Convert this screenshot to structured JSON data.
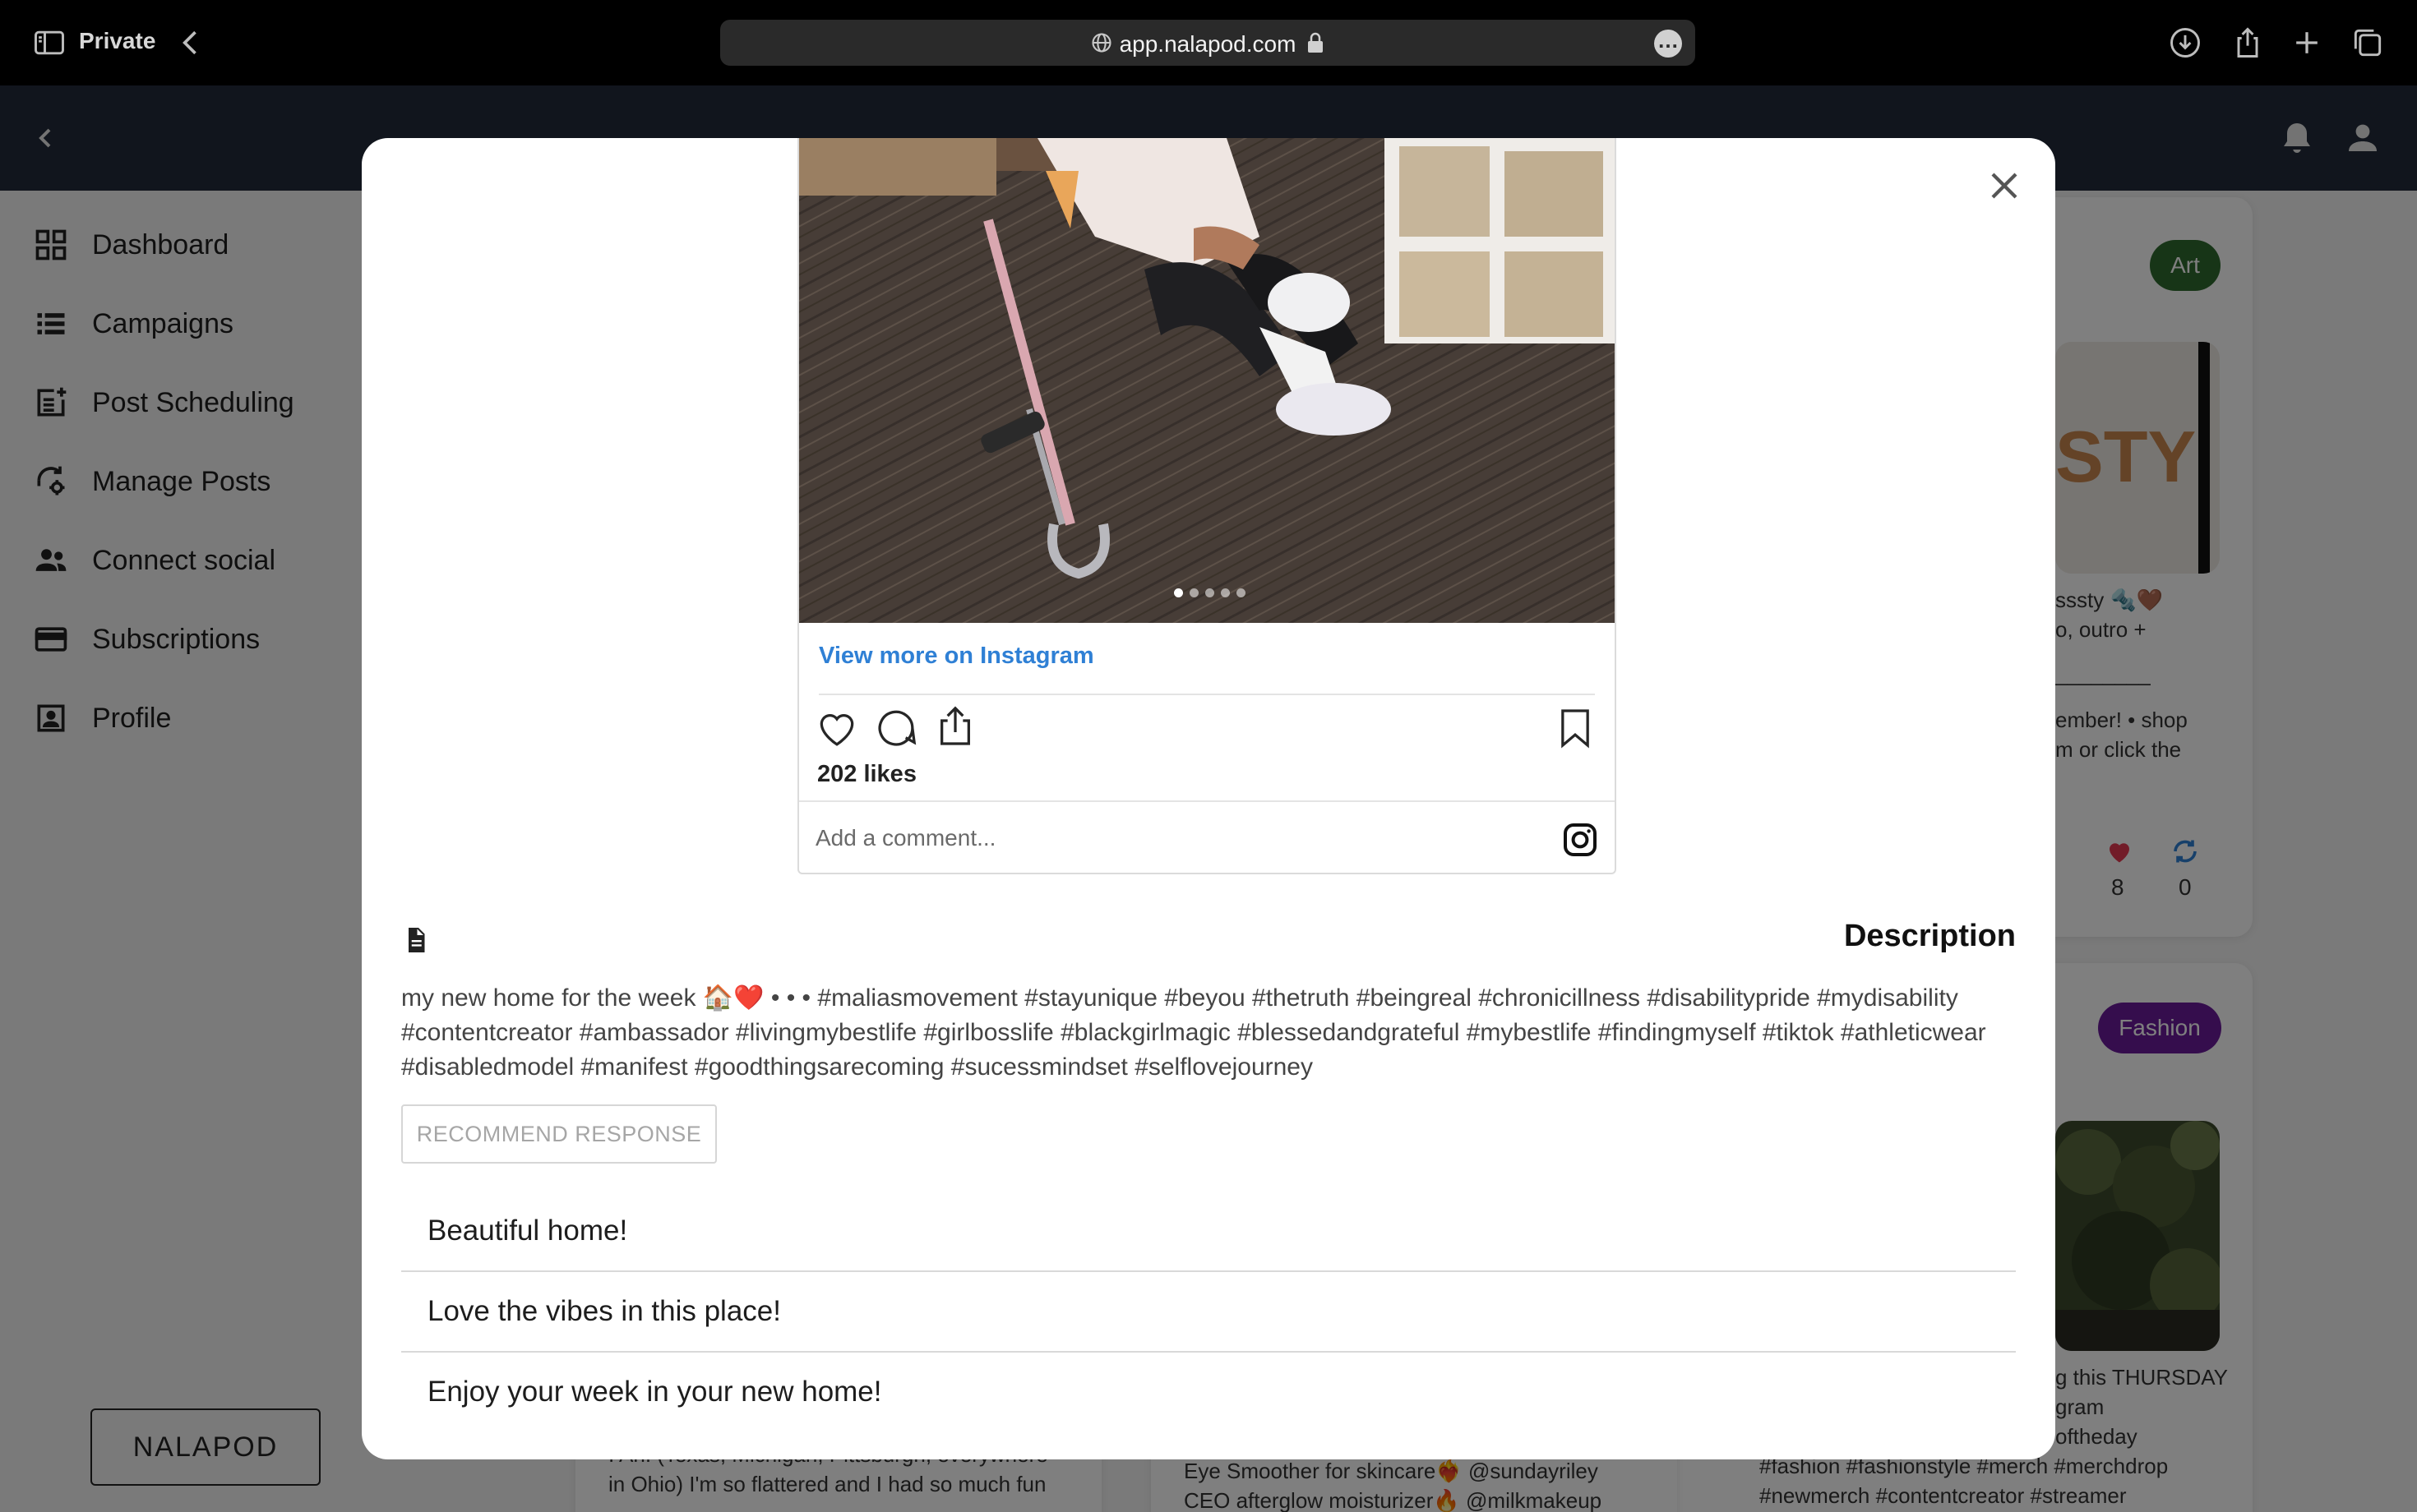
{
  "browser": {
    "private_label": "Private",
    "url": "app.nalapod.com"
  },
  "sidebar": {
    "items": [
      {
        "label": "Dashboard",
        "icon": "dashboard-icon"
      },
      {
        "label": "Campaigns",
        "icon": "campaigns-list-icon"
      },
      {
        "label": "Post Scheduling",
        "icon": "post-scheduling-icon"
      },
      {
        "label": "Manage Posts",
        "icon": "manage-posts-icon"
      },
      {
        "label": "Connect social",
        "icon": "people-icon"
      },
      {
        "label": "Subscriptions",
        "icon": "credit-card-icon"
      },
      {
        "label": "Profile",
        "icon": "profile-card-icon"
      }
    ],
    "brand_button": "NALAPOD"
  },
  "background_cards": {
    "art_card": {
      "tag": "Art",
      "tag_color": "#2f6b2f",
      "caption_lines": [
        "sssty 🔩🤎",
        "o, outro +",
        "________",
        "ember! • shop",
        "m or click the"
      ],
      "likes": "8",
      "shares": "0"
    },
    "fashion_card": {
      "tag": "Fashion",
      "tag_color": "#6a1b9a",
      "caption_lines": [
        "g this THURSDAY",
        "gram",
        "oftheday",
        "#fashion #fashionstyle #merch #merchdrop",
        "#newmerch #contentcreator #streamer"
      ]
    },
    "left_card_lines": [
      "I An. (Texas, Michigan, Pittsburgh, everywhere",
      "in Ohio) I'm so flattered and I had so much fun"
    ],
    "middle_card_lines": [
      "Eye Smoother for skincare❤️‍🔥 @sundayriley",
      "CEO afterglow moisturizer🔥 @milkmakeup"
    ]
  },
  "modal": {
    "instagram": {
      "view_more": "View more on Instagram",
      "likes": "202 likes",
      "comment_placeholder": "Add a comment...",
      "carousel_count": 5,
      "carousel_active": 1
    },
    "description_title": "Description",
    "description_text": "my new home for the week 🏠❤️ • • • #maliasmovement #stayunique #beyou #thetruth #beingreal #chronicillness #disabilitypride #mydisability #contentcreator #ambassador #livingmybestlife #girlbosslife #blackgirlmagic #blessedandgrateful #mybestlife #findingmyself #tiktok #athleticwear #disabledmodel #manifest #goodthingsarecoming #sucessmindset #selflovejourney",
    "recommend_button": "RECOMMEND RESPONSE",
    "responses": [
      "Beautiful home!",
      "Love the vibes in this place!",
      "Enjoy your week in your new home!"
    ]
  },
  "colors": {
    "header_bg": "#222b3a",
    "link_blue": "#2f80d5"
  }
}
